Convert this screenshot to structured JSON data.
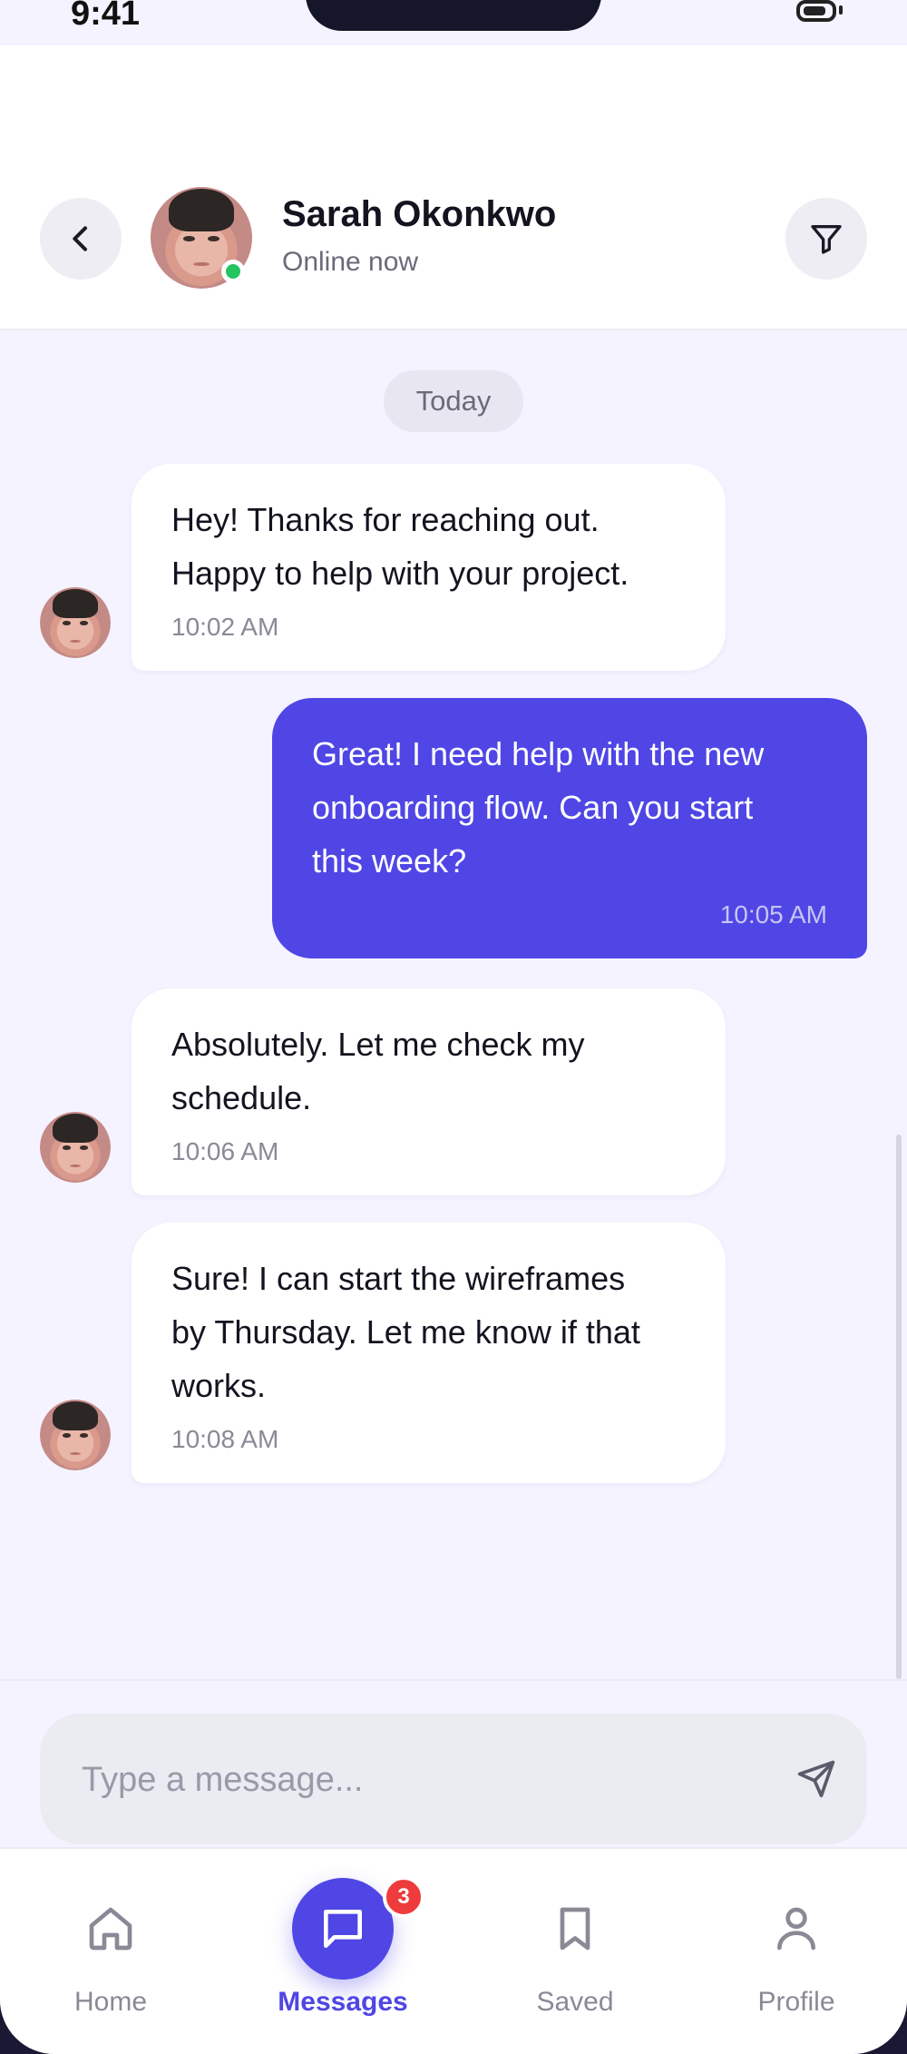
{
  "status_bar": {
    "time": "9:41"
  },
  "header": {
    "contact_name": "Sarah Okonkwo",
    "contact_status": "Online now",
    "back_icon": "chevron-left-icon",
    "filter_icon": "filter-icon",
    "status_color": "#22c55e"
  },
  "chat": {
    "date_label": "Today",
    "messages": [
      {
        "direction": "incoming",
        "lines": [
          "Hey! Thanks for reaching out.",
          "Happy to help with your project."
        ],
        "time": "10:02 AM"
      },
      {
        "direction": "outgoing",
        "lines": [
          "Great! I need help with the new",
          "onboarding flow. Can you start",
          "this week?"
        ],
        "time": "10:05 AM"
      },
      {
        "direction": "incoming",
        "lines": [
          "Absolutely. Let me check my",
          "schedule."
        ],
        "time": "10:06 AM"
      },
      {
        "direction": "incoming",
        "lines": [
          "Sure! I can start the wireframes",
          "by Thursday. Let me know if that",
          "works."
        ],
        "time": "10:08 AM"
      }
    ]
  },
  "composer": {
    "placeholder": "Type a message...",
    "send_icon": "send-icon"
  },
  "tabbar": {
    "tabs": [
      {
        "label": "Home",
        "icon": "home-icon"
      },
      {
        "label": "Messages",
        "icon": "chat-icon",
        "badge": "3",
        "active": true
      },
      {
        "label": "Saved",
        "icon": "bookmark-icon"
      },
      {
        "label": "Profile",
        "icon": "user-icon"
      }
    ]
  },
  "colors": {
    "accent": "#4f46e5",
    "background": "#f5f3ff",
    "badge": "#ef3b3b"
  }
}
